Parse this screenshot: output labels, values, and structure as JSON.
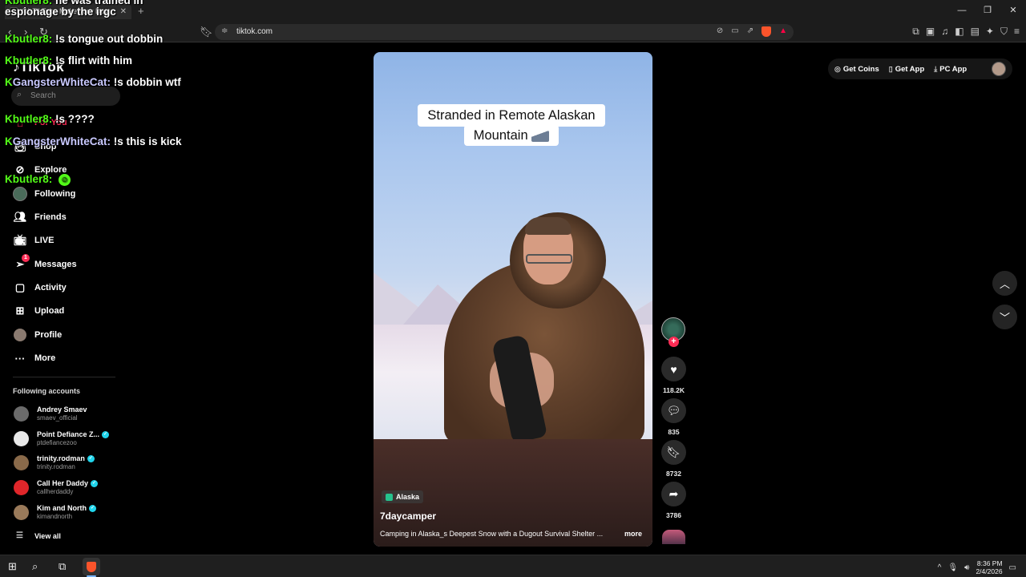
{
  "browser": {
    "tab_title": "(1) TikTok - Make Your Day",
    "url": "tiktok.com"
  },
  "tiktok": {
    "logo": "TikTok",
    "search_placeholder": "Search",
    "nav": [
      {
        "label": "For You",
        "icon": "home-icon"
      },
      {
        "label": "Shop",
        "icon": "bag-icon"
      },
      {
        "label": "Explore",
        "icon": "compass-icon"
      },
      {
        "label": "Following",
        "icon": "following-avatar"
      },
      {
        "label": "Friends",
        "icon": "friends-icon"
      },
      {
        "label": "LIVE",
        "icon": "live-icon"
      },
      {
        "label": "Messages",
        "icon": "messages-icon",
        "badge": "1"
      },
      {
        "label": "Activity",
        "icon": "activity-icon"
      },
      {
        "label": "Upload",
        "icon": "upload-icon"
      },
      {
        "label": "Profile",
        "icon": "profile-avatar"
      },
      {
        "label": "More",
        "icon": "more-icon"
      }
    ],
    "following_title": "Following accounts",
    "accounts": [
      {
        "name": "Andrey Smaev",
        "handle": "smaev_official",
        "verified": false,
        "color": "#6b6b6b"
      },
      {
        "name": "Point Defiance Z...",
        "handle": "ptdefiancezoo",
        "verified": true,
        "color": "#e8e8e8"
      },
      {
        "name": "trinity.rodman",
        "handle": "trinity.rodman",
        "verified": true,
        "color": "#8a6a4a"
      },
      {
        "name": "Call Her Daddy",
        "handle": "callherdaddy",
        "verified": true,
        "color": "#e0262a"
      },
      {
        "name": "Kim and North",
        "handle": "kimandnorth",
        "verified": true,
        "color": "#9a7a5a"
      }
    ],
    "view_all": "View all",
    "header": {
      "get_coins": "Get Coins",
      "get_app": "Get App",
      "pc_app": "PC App"
    },
    "video": {
      "caption_line1": "Stranded in Remote Alaskan",
      "caption_line2": "Mountain",
      "location": "Alaska",
      "author": "7daycamper",
      "description": "Camping in Alaska_s Deepest Snow with a Dugout Survival Shelter ...",
      "more": "more"
    },
    "actions": {
      "likes": "118.2K",
      "comments": "835",
      "saves": "8732",
      "shares": "3786"
    }
  },
  "chat": [
    {
      "user": "butler8",
      "message": "he was trained in espionage by the irgc"
    },
    {
      "user": "butler8",
      "message": "!s tongue out dobbin"
    },
    {
      "user": "butler8",
      "message": "!s flirt with him"
    },
    {
      "user": "GangsterWhiteCat",
      "message": "!s dobbin wtf"
    },
    {
      "user": "butler8",
      "message": "!s ????"
    },
    {
      "user": "GangsterWhiteCat",
      "message": "!s this is kick"
    },
    {
      "user": "butler8",
      "message": ""
    }
  ],
  "taskbar": {
    "time": "8:36 PM",
    "date": "2/4/2026"
  },
  "colors": {
    "accent": "#fe2c55",
    "kick_green": "#53fc18",
    "verified": "#20d5ec"
  }
}
